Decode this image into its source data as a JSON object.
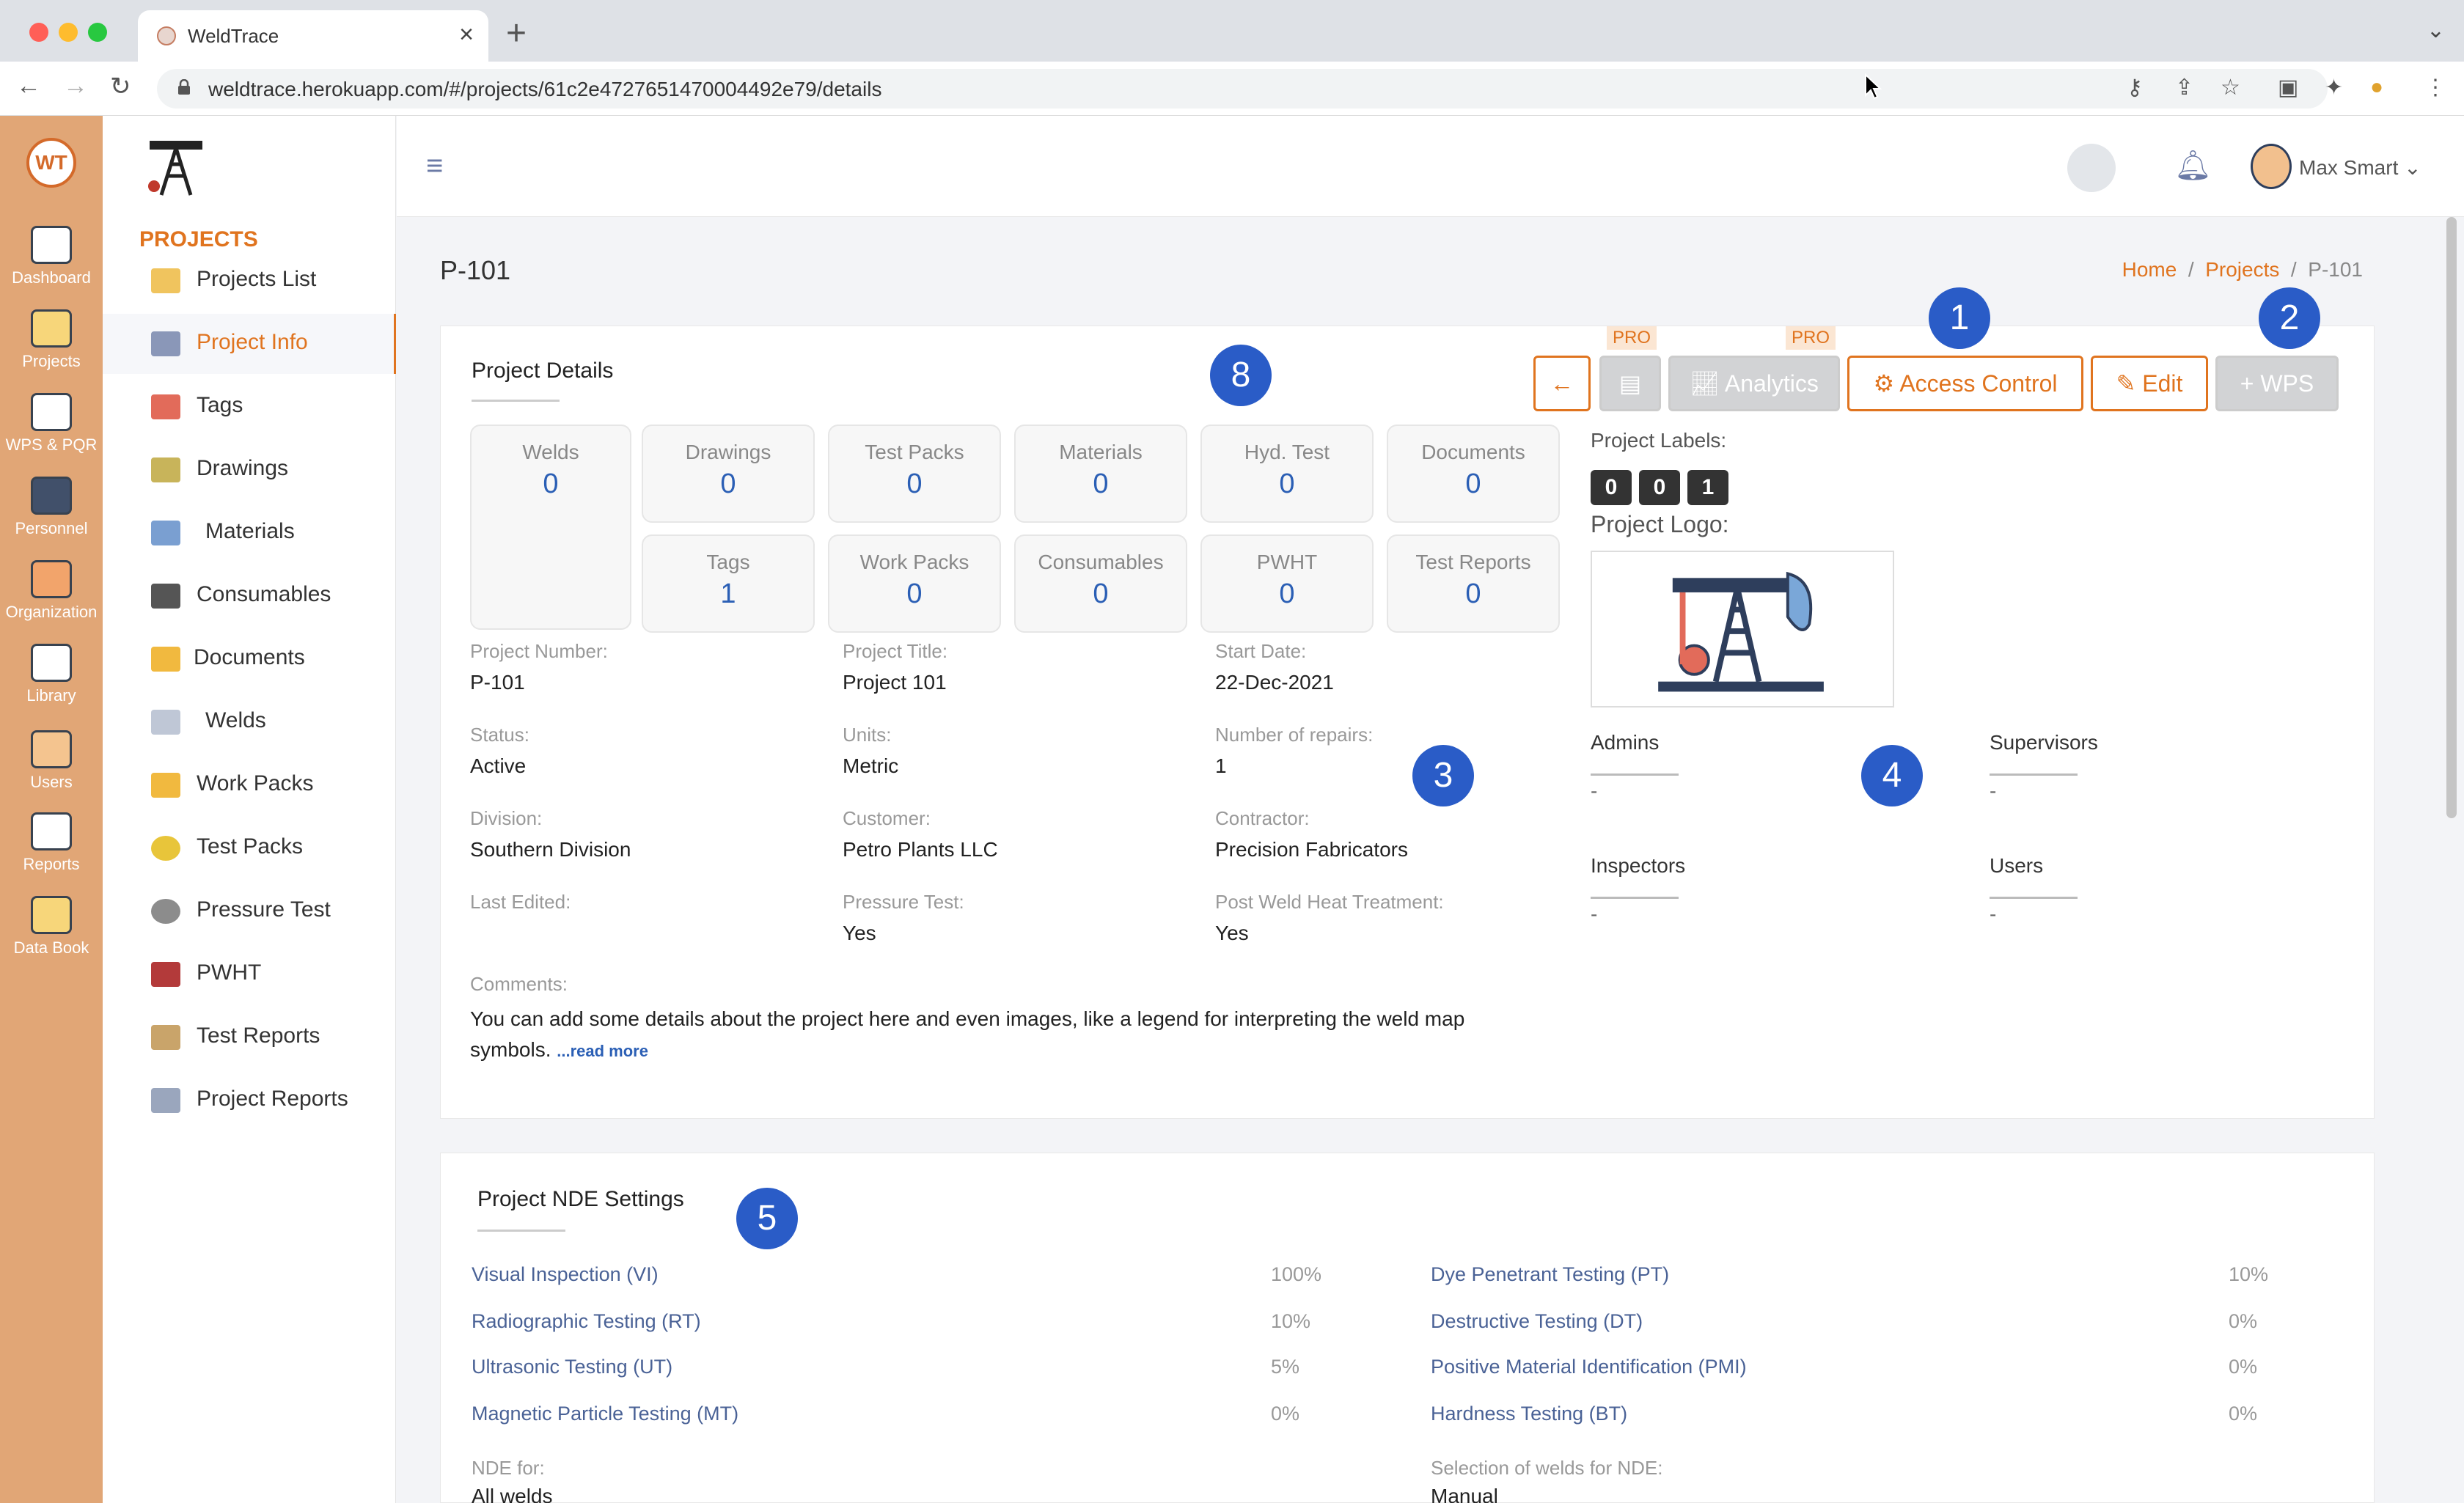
{
  "browser": {
    "tab_title": "WeldTrace",
    "url": "weldtrace.herokuapp.com/#/projects/61c2e4727651470004492e79/details"
  },
  "rail": {
    "items": [
      {
        "label": "Dashboard",
        "icon": "dashboard-icon"
      },
      {
        "label": "Projects",
        "icon": "projects-icon"
      },
      {
        "label": "WPS & PQR",
        "icon": "wps-icon"
      },
      {
        "label": "Personnel",
        "icon": "personnel-icon"
      },
      {
        "label": "Organization",
        "icon": "organization-icon"
      },
      {
        "label": "Library",
        "icon": "library-icon"
      },
      {
        "label": "Users",
        "icon": "users-icon"
      },
      {
        "label": "Reports",
        "icon": "reports-icon"
      },
      {
        "label": "Data Book",
        "icon": "databook-icon"
      }
    ]
  },
  "sidebar": {
    "heading": "PROJECTS",
    "items": [
      {
        "label": "Projects List"
      },
      {
        "label": "Project Info"
      },
      {
        "label": "Tags"
      },
      {
        "label": "Drawings"
      },
      {
        "label": "Materials"
      },
      {
        "label": "Consumables"
      },
      {
        "label": "Documents"
      },
      {
        "label": "Welds"
      },
      {
        "label": "Work Packs"
      },
      {
        "label": "Test Packs"
      },
      {
        "label": "Pressure Test"
      },
      {
        "label": "PWHT"
      },
      {
        "label": "Test Reports"
      },
      {
        "label": "Project Reports"
      }
    ]
  },
  "header": {
    "user_name": "Max Smart"
  },
  "page": {
    "title": "P-101",
    "breadcrumb": {
      "home": "Home",
      "projects": "Projects",
      "current": "P-101"
    }
  },
  "details": {
    "card_title": "Project Details",
    "buttons": {
      "back": "←",
      "pro1": "PRO",
      "pro2": "PRO",
      "analytics": "Analytics",
      "access": "Access Control",
      "edit": "Edit",
      "wps": "WPS"
    },
    "stats": {
      "welds": {
        "label": "Welds",
        "value": "0"
      },
      "drawings": {
        "label": "Drawings",
        "value": "0"
      },
      "test_packs": {
        "label": "Test Packs",
        "value": "0"
      },
      "materials": {
        "label": "Materials",
        "value": "0"
      },
      "hyd_test": {
        "label": "Hyd. Test",
        "value": "0"
      },
      "documents": {
        "label": "Documents",
        "value": "0"
      },
      "tags": {
        "label": "Tags",
        "value": "1"
      },
      "work_packs": {
        "label": "Work Packs",
        "value": "0"
      },
      "consumables": {
        "label": "Consumables",
        "value": "0"
      },
      "pwht": {
        "label": "PWHT",
        "value": "0"
      },
      "test_reports": {
        "label": "Test Reports",
        "value": "0"
      }
    },
    "fields": {
      "project_number": {
        "label": "Project Number:",
        "value": "P-101"
      },
      "project_title": {
        "label": "Project Title:",
        "value": "Project 101"
      },
      "start_date": {
        "label": "Start Date:",
        "value": "22-Dec-2021"
      },
      "status": {
        "label": "Status:",
        "value": "Active"
      },
      "units": {
        "label": "Units:",
        "value": "Metric"
      },
      "repairs": {
        "label": "Number of repairs:",
        "value": "1"
      },
      "division": {
        "label": "Division:",
        "value": "Southern Division"
      },
      "customer": {
        "label": "Customer:",
        "value": "Petro Plants LLC"
      },
      "contractor": {
        "label": "Contractor:",
        "value": "Precision Fabricators"
      },
      "last_edited": {
        "label": "Last Edited:",
        "value": ""
      },
      "pressure_test": {
        "label": "Pressure Test:",
        "value": "Yes"
      },
      "pwht": {
        "label": "Post Weld Heat Treatment:",
        "value": "Yes"
      },
      "comments": {
        "label": "Comments:",
        "value": "You can add some details about the project here and even images, like a legend for interpreting the weld map symbols.",
        "more": "...read more"
      }
    },
    "labels_title": "Project Labels:",
    "labels": [
      "0",
      "0",
      "1"
    ],
    "logo_title": "Project Logo:",
    "roles": {
      "admins": {
        "title": "Admins",
        "value": "-"
      },
      "supervisors": {
        "title": "Supervisors",
        "value": "-"
      },
      "inspectors": {
        "title": "Inspectors",
        "value": "-"
      },
      "users": {
        "title": "Users",
        "value": "-"
      }
    }
  },
  "nde": {
    "card_title": "Project NDE Settings",
    "left": [
      {
        "name": "Visual Inspection (VI)",
        "pct": "100%"
      },
      {
        "name": "Radiographic Testing (RT)",
        "pct": "10%"
      },
      {
        "name": "Ultrasonic Testing (UT)",
        "pct": "5%"
      },
      {
        "name": "Magnetic Particle Testing (MT)",
        "pct": "0%"
      }
    ],
    "right": [
      {
        "name": "Dye Penetrant Testing (PT)",
        "pct": "10%"
      },
      {
        "name": "Destructive Testing (DT)",
        "pct": "0%"
      },
      {
        "name": "Positive Material Identification (PMI)",
        "pct": "0%"
      },
      {
        "name": "Hardness Testing (BT)",
        "pct": "0%"
      }
    ],
    "nde_for": {
      "label": "NDE for:",
      "value": "All welds"
    },
    "selection": {
      "label": "Selection of welds for NDE:",
      "value": "Manual"
    }
  },
  "callouts": [
    "1",
    "2",
    "3",
    "4",
    "5",
    "8"
  ],
  "colors": {
    "accent": "#e0741f",
    "rail": "#e1a676",
    "badge": "#2a5cc7",
    "stat_value": "#2b5fb5"
  }
}
